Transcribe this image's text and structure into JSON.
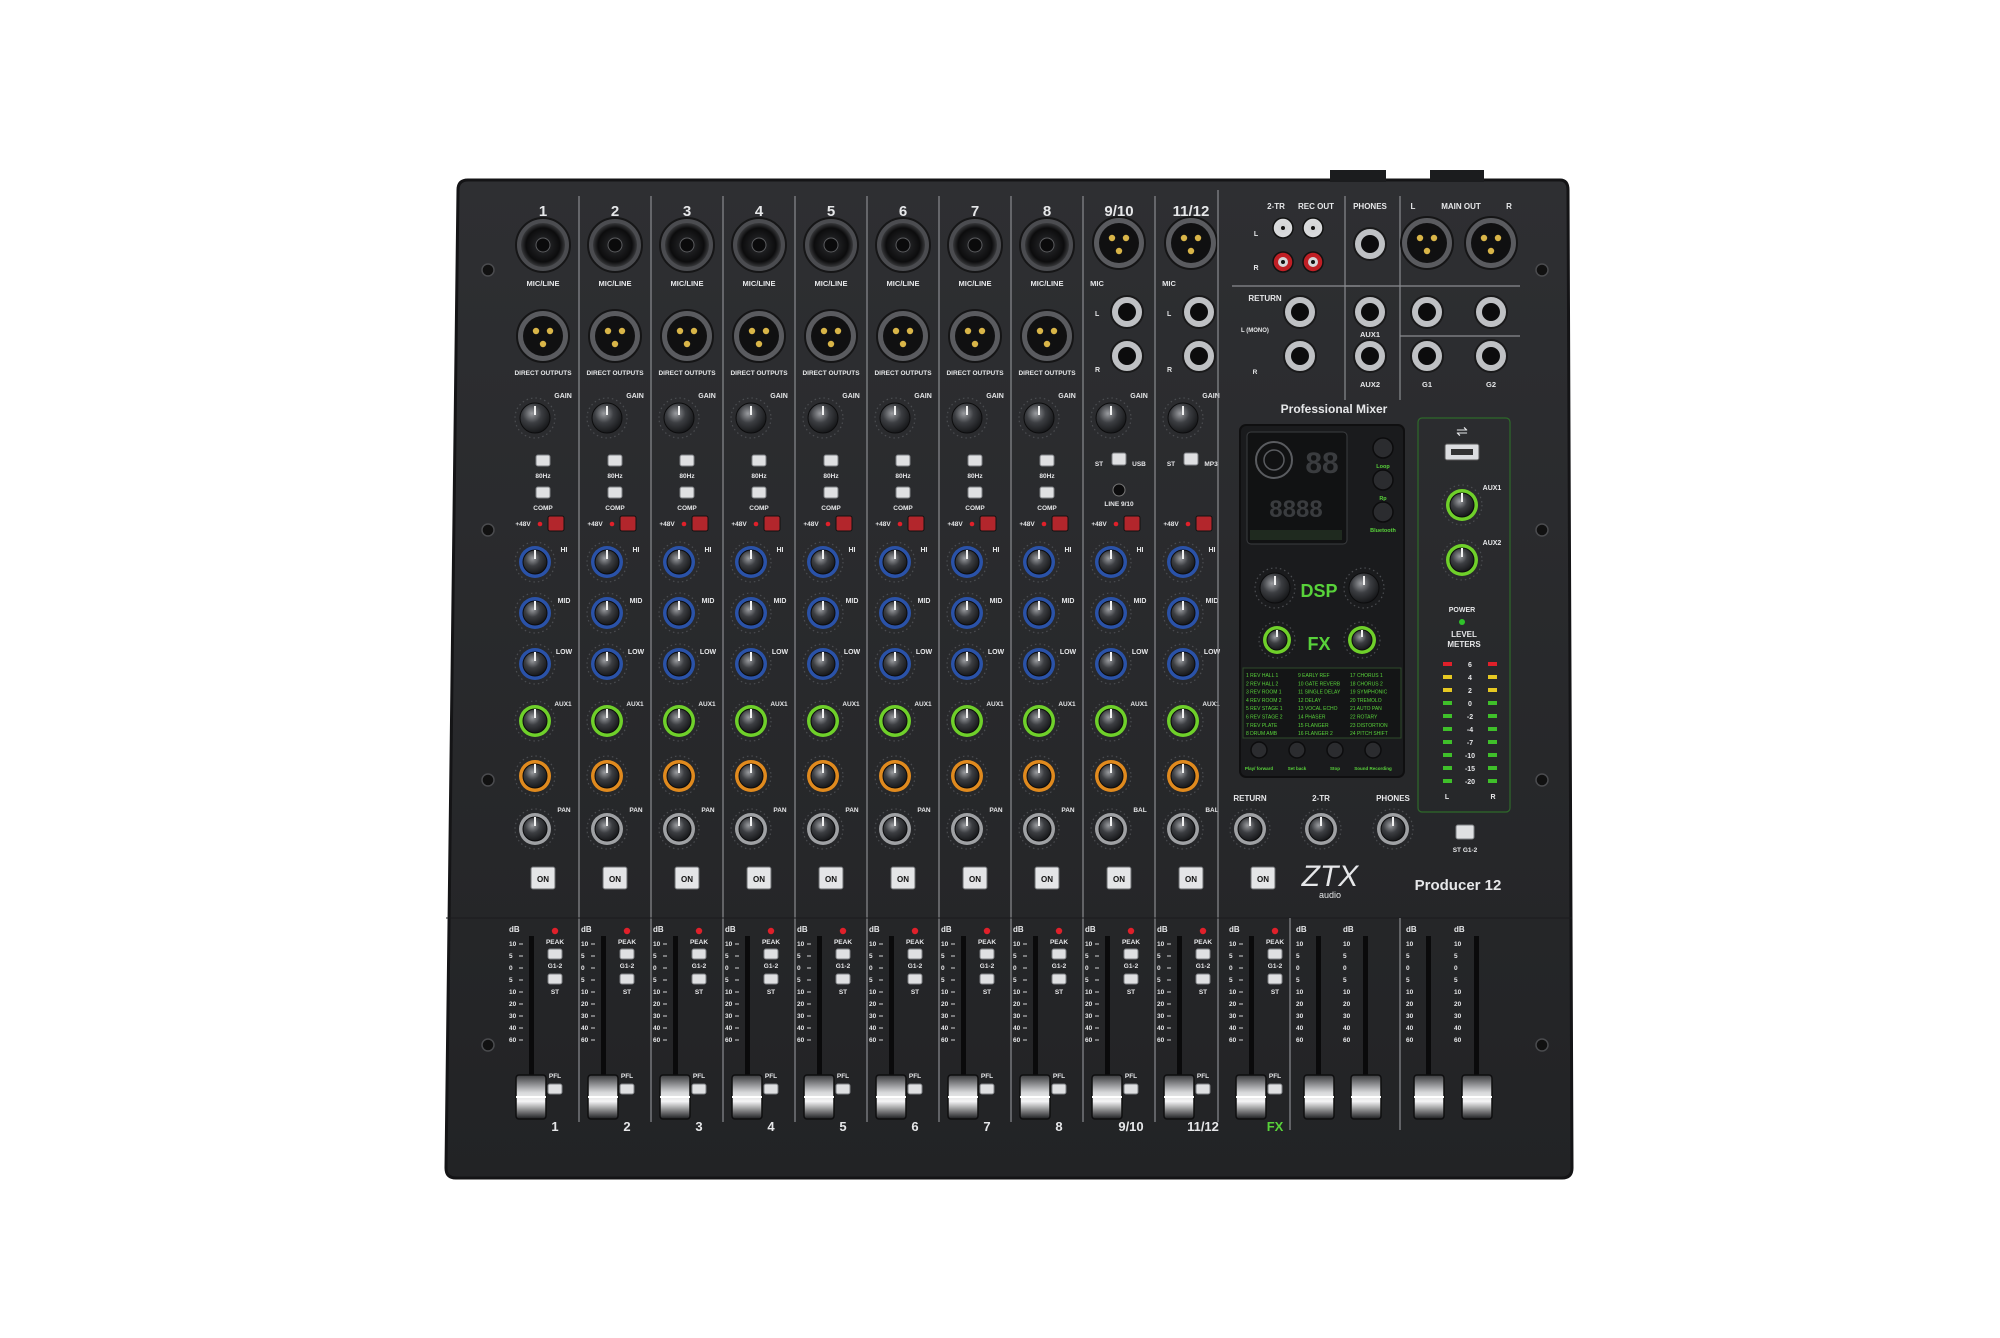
{
  "brand": {
    "logo_text": "ZTX",
    "logo_sub": "audio",
    "model": "Producer 12",
    "panel_title": "Professional Mixer"
  },
  "channels": [
    {
      "number": "1",
      "input_label": "MIC/LINE",
      "type": "mono"
    },
    {
      "number": "2",
      "input_label": "MIC/LINE",
      "type": "mono"
    },
    {
      "number": "3",
      "input_label": "MIC/LINE",
      "type": "mono"
    },
    {
      "number": "4",
      "input_label": "MIC/LINE",
      "type": "mono"
    },
    {
      "number": "5",
      "input_label": "MIC/LINE",
      "type": "mono"
    },
    {
      "number": "6",
      "input_label": "MIC/LINE",
      "type": "mono"
    },
    {
      "number": "7",
      "input_label": "MIC/LINE",
      "type": "mono"
    },
    {
      "number": "8",
      "input_label": "MIC/LINE",
      "type": "mono"
    },
    {
      "number": "9/10",
      "input_label": "MIC",
      "type": "stereo"
    },
    {
      "number": "11/12",
      "input_label": "MIC",
      "type": "stereo"
    }
  ],
  "labels": {
    "direct_outputs": "DIRECT OUTPUTS",
    "gain": "GAIN",
    "hz": "80Hz",
    "comp": "COMP",
    "phantom": "+48V",
    "hi": "HI",
    "mid": "MID",
    "low": "LOW",
    "aux1": "AUX1",
    "pan": "PAN",
    "bal": "BAL",
    "on": "ON",
    "peak": "PEAK",
    "g12": "G1-2",
    "st": "ST",
    "pfl": "PFL",
    "db": "dB",
    "line_910": "LINE 9/10",
    "usb": "USB",
    "mp3": "MP3",
    "l_mono": "L (MONO)",
    "r": "R",
    "l": "L"
  },
  "fader_scale": [
    "10",
    "5",
    "0",
    "5",
    "10",
    "20",
    "30",
    "40",
    "60"
  ],
  "master_section": {
    "two_tr": "2-TR",
    "rec_out": "REC OUT",
    "phones": "PHONES",
    "main_out": "MAIN OUT",
    "return": "RETURN",
    "aux1": "AUX1",
    "aux2": "AUX2",
    "g1": "G1",
    "g2": "G2",
    "power": "POWER",
    "level_meters": "LEVEL METERS",
    "meter_scale": [
      "6",
      "4",
      "2",
      "0",
      "-2",
      "-4",
      "-7",
      "-10",
      "-15",
      "-20"
    ],
    "fx": "FX",
    "return_knob": "RETURN",
    "two_tr_knob": "2-TR",
    "phones_knob": "PHONES",
    "st_g12": "ST    G1-2"
  },
  "dsp": {
    "display_digits": "88",
    "display_long": "8888",
    "dsp_label": "DSP",
    "fx_label": "FX",
    "buttons": [
      "Loop",
      "Rp",
      "Bluetooth"
    ],
    "transport": [
      "Play/ forward",
      "Set back",
      "Stop",
      "Sound Recording"
    ],
    "presets": [
      "1 REV HALL 1",
      "9 EARLY REF",
      "17 CHORUS 1",
      "2 REV HALL 2",
      "10 GATE REVERB",
      "18 CHORUS 2",
      "3 REV ROOM 1",
      "11 SINGLE DELAY",
      "19 SYMPHONIC",
      "4 REV ROOM 2",
      "12 DELAY",
      "20 TREMOLO",
      "5 REV STAGE 1",
      "13 VOCAL ECHO",
      "21 AUTO PAN",
      "6 REV STAGE 2",
      "14 PHASER",
      "22 ROTARY",
      "7 REV PLATE",
      "15 FLANGER",
      "23 DISTORTION",
      "8 DRUM AMB",
      "16 FLANGER 2",
      "24 PITCH SHIFT"
    ]
  },
  "colors": {
    "body": "#262729",
    "panel": "#2c2d30",
    "line": "#8a8c90",
    "hi_knob": "#2a52a8",
    "aux1_knob": "#6fd02a",
    "aux2_knob": "#e08a1e",
    "peak_led": "#e0202a",
    "phantom_led": "#b3262c",
    "green_text": "#58d23a"
  }
}
